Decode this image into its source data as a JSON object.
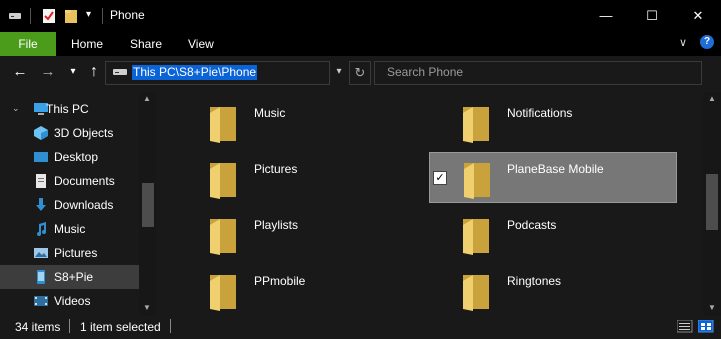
{
  "window": {
    "title": "Phone",
    "minimize_glyph": "—",
    "maximize_glyph": "☐",
    "close_glyph": "✕"
  },
  "ribbon": {
    "tabs": [
      "File",
      "Home",
      "Share",
      "View"
    ],
    "expand_glyph": "∨",
    "help_glyph": "?"
  },
  "address": {
    "path": "This PC\\S8+Pie\\Phone",
    "search_placeholder": "Search Phone"
  },
  "nav": {
    "items": [
      {
        "label": "This PC",
        "icon": "computer-icon"
      },
      {
        "label": "3D Objects",
        "icon": "cube-icon"
      },
      {
        "label": "Desktop",
        "icon": "desktop-icon"
      },
      {
        "label": "Documents",
        "icon": "document-icon"
      },
      {
        "label": "Downloads",
        "icon": "download-icon"
      },
      {
        "label": "Music",
        "icon": "music-icon"
      },
      {
        "label": "Pictures",
        "icon": "pictures-icon"
      },
      {
        "label": "S8+Pie",
        "icon": "phone-icon",
        "selected": true
      },
      {
        "label": "Videos",
        "icon": "video-icon"
      }
    ]
  },
  "folders": [
    {
      "name": "Music"
    },
    {
      "name": "Notifications"
    },
    {
      "name": "Pictures"
    },
    {
      "name": "PlaneBase Mobile",
      "selected": true,
      "checked": true
    },
    {
      "name": "Playlists"
    },
    {
      "name": "Podcasts"
    },
    {
      "name": "PPmobile"
    },
    {
      "name": "Ringtones"
    }
  ],
  "status": {
    "count": "34 items",
    "selection": "1 item selected"
  },
  "colors": {
    "accent_file_tab": "#4a9c1a",
    "selection_blue": "#0a64d8",
    "folder_yellow": "#e8c25a"
  }
}
